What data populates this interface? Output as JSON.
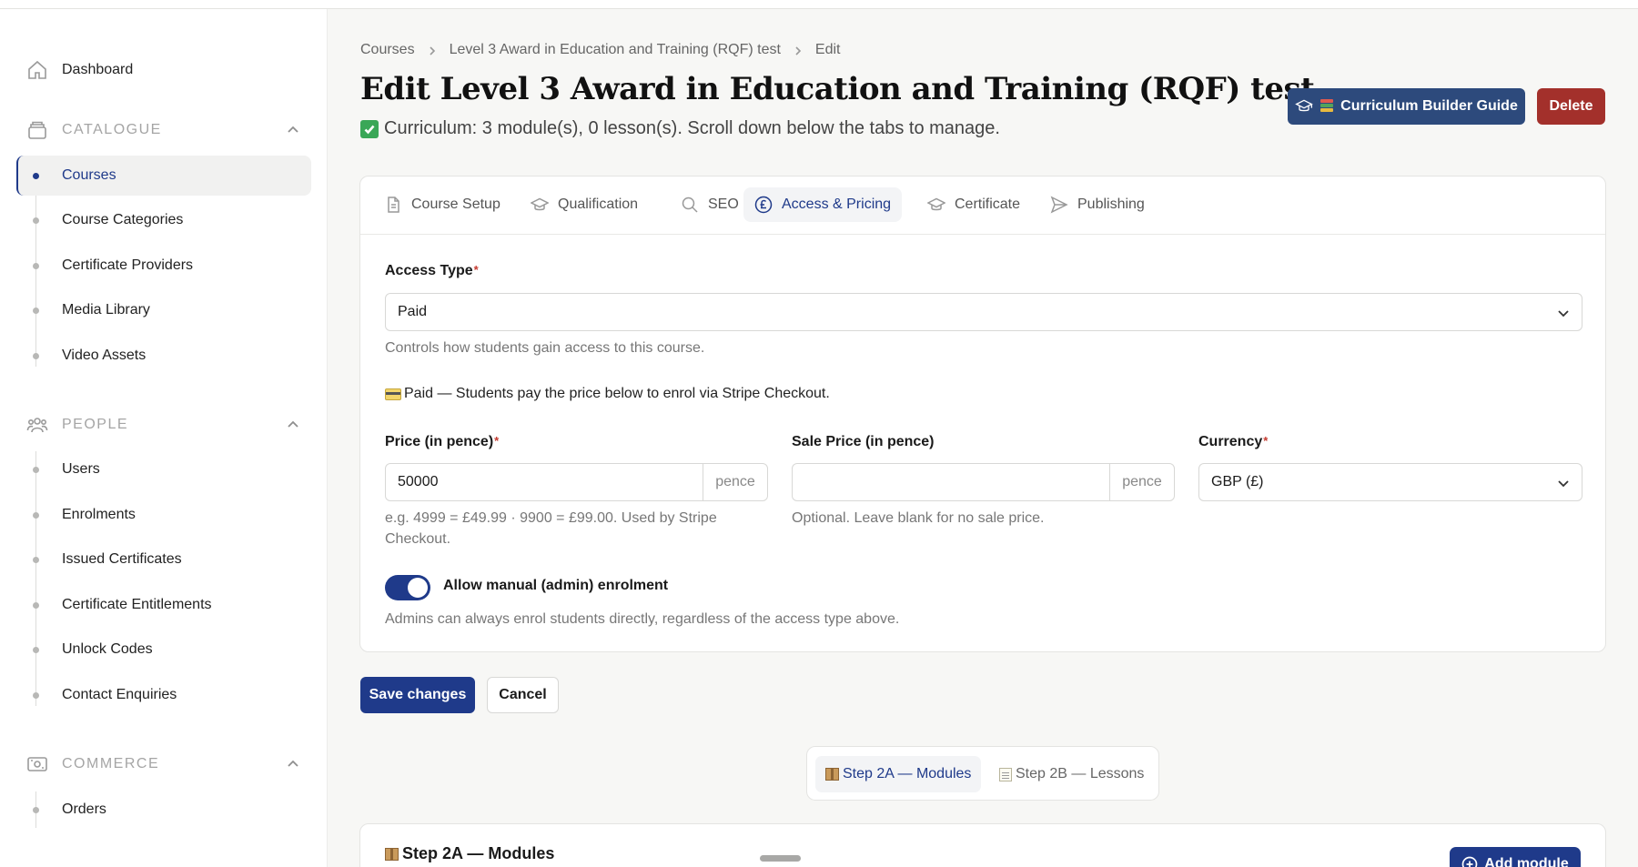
{
  "sidebar": {
    "dashboard": "Dashboard",
    "sections": [
      {
        "title": "CATALOGUE",
        "items": [
          "Courses",
          "Course Categories",
          "Certificate Providers",
          "Media Library",
          "Video Assets"
        ]
      },
      {
        "title": "PEOPLE",
        "items": [
          "Users",
          "Enrolments",
          "Issued Certificates",
          "Certificate Entitlements",
          "Unlock Codes",
          "Contact Enquiries"
        ]
      },
      {
        "title": "COMMERCE",
        "items": [
          "Orders"
        ]
      }
    ],
    "active_item": "Courses"
  },
  "breadcrumb": [
    "Courses",
    "Level 3 Award in Education and Training (RQF) test",
    "Edit"
  ],
  "page_title": "Edit Level 3 Award in Education and Training (RQF) test",
  "summary": "Curriculum: 3 module(s), 0 lesson(s). Scroll down below the tabs to manage.",
  "header_buttons": {
    "guide": "Curriculum Builder Guide",
    "delete": "Delete"
  },
  "tabs": [
    {
      "label": "Course Setup",
      "icon": "document-icon"
    },
    {
      "label": "Qualification",
      "icon": "graduation-cap-icon"
    },
    {
      "label": "SEO",
      "icon": "search-icon"
    },
    {
      "label": "Access & Pricing",
      "icon": "pound-icon",
      "active": true
    },
    {
      "label": "Certificate",
      "icon": "graduation-cap-icon"
    },
    {
      "label": "Publishing",
      "icon": "send-icon"
    }
  ],
  "form": {
    "access_type": {
      "label": "Access Type",
      "value": "Paid",
      "help": "Controls how students gain access to this course."
    },
    "paid_note": "Paid — Students pay the price below to enrol via Stripe Checkout.",
    "price": {
      "label": "Price (in pence)",
      "value": "50000",
      "suffix": "pence",
      "help": "e.g. 4999 = £49.99 · 9900 = £99.00. Used by Stripe Checkout."
    },
    "sale_price": {
      "label": "Sale Price (in pence)",
      "value": "",
      "suffix": "pence",
      "help": "Optional. Leave blank for no sale price."
    },
    "currency": {
      "label": "Currency",
      "value": "GBP (£)"
    },
    "manual_enrolment": {
      "label": "Allow manual (admin) enrolment",
      "enabled": true,
      "help": "Admins can always enrol students directly, regardless of the access type above."
    }
  },
  "actions": {
    "save": "Save changes",
    "cancel": "Cancel"
  },
  "steps": [
    {
      "label": "Step 2A — Modules",
      "active": true
    },
    {
      "label": "Step 2B — Lessons",
      "active": false
    }
  ],
  "modules_section": {
    "title": "Step 2A — Modules",
    "add_button": "Add module"
  },
  "colors": {
    "primary": "#1f3a8a",
    "guide_button": "#2d4a7c",
    "delete_button": "#a3302b"
  }
}
